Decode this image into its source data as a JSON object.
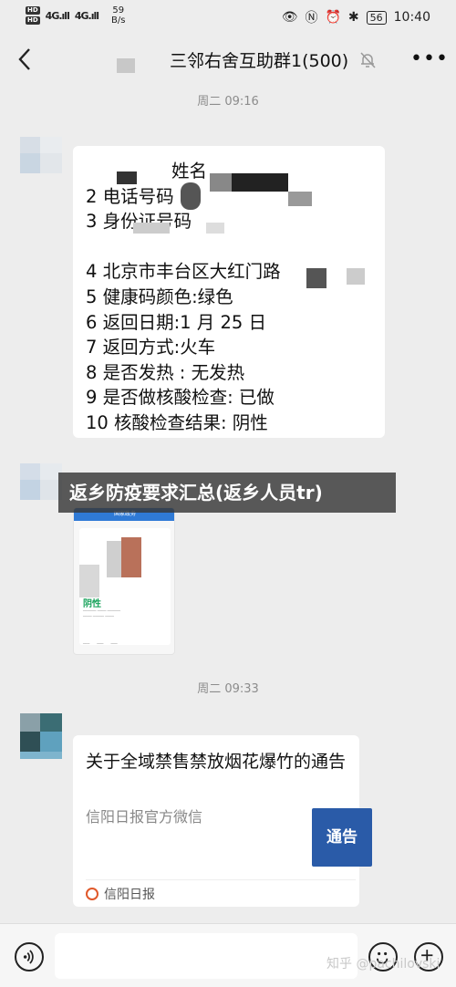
{
  "status_bar": {
    "hd1": "HD",
    "hd2": "HD",
    "signal1": "4G.ıll",
    "signal2": "4G.ıll",
    "speed_value": "59",
    "speed_unit": "B/s",
    "battery": "56",
    "time": "10:40"
  },
  "header": {
    "title": "三邻右舍互助群1(500)"
  },
  "timestamps": [
    "周二 09:16",
    "周二 09:33"
  ],
  "message1": {
    "lines": [
      "姓名",
      "2 电话号码",
      "3 身份证号码",
      "4 北京市丰台区大红门路",
      "5 健康码颜色:绿色",
      "6 返回日期:1 月 25 日",
      "7 返回方式:火车",
      "8 是否发热 : 无发热",
      "9 是否做核酸检查: 已做",
      "10 核酸检查结果: 阴性"
    ]
  },
  "overlay_banner": "返乡防疫要求汇总(返乡人员tr)",
  "image_message": {
    "header": "国家政务",
    "status": "阴性"
  },
  "article": {
    "title": "关于全域禁售禁放烟花爆竹的通告",
    "source": "信阳日报官方微信",
    "thumb_text": "通告",
    "footer": "信阳日报"
  },
  "watermark": "知乎 @pachilovski",
  "colors": {
    "background": "#ededed",
    "bubble": "#ffffff",
    "accent_blue": "#2a5ba8",
    "status_green": "#1aa35c"
  }
}
